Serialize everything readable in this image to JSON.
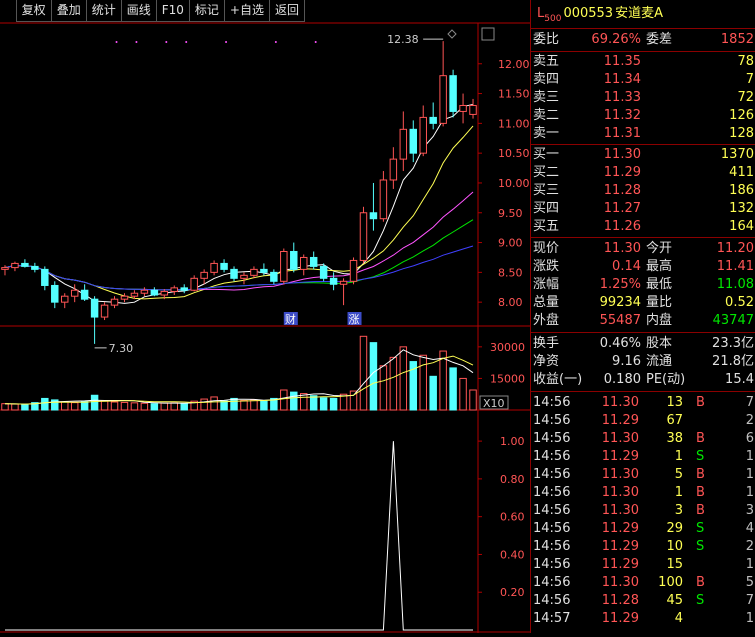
{
  "toolbar": [
    "复权",
    "叠加",
    "统计",
    "画线",
    "F10",
    "标记",
    "+自选",
    "返回"
  ],
  "stock": {
    "prefix": "L",
    "sub": "500",
    "code": "000553",
    "name": "安道麦A"
  },
  "commission": {
    "ratio_label": "委比",
    "ratio": "69.26%",
    "diff_label": "委差",
    "diff": "1852"
  },
  "asks": [
    {
      "label": "卖五",
      "price": "11.35",
      "vol": "78"
    },
    {
      "label": "卖四",
      "price": "11.34",
      "vol": "7"
    },
    {
      "label": "卖三",
      "price": "11.33",
      "vol": "72"
    },
    {
      "label": "卖二",
      "price": "11.32",
      "vol": "126"
    },
    {
      "label": "卖一",
      "price": "11.31",
      "vol": "128"
    }
  ],
  "bids": [
    {
      "label": "买一",
      "price": "11.30",
      "vol": "1370"
    },
    {
      "label": "买二",
      "price": "11.29",
      "vol": "411"
    },
    {
      "label": "买三",
      "price": "11.28",
      "vol": "186"
    },
    {
      "label": "买四",
      "price": "11.27",
      "vol": "132"
    },
    {
      "label": "买五",
      "price": "11.26",
      "vol": "164"
    }
  ],
  "quote": [
    {
      "l1": "现价",
      "v1": "11.30",
      "c1": "red",
      "l2": "今开",
      "v2": "11.20",
      "c2": "red"
    },
    {
      "l1": "涨跌",
      "v1": "0.14",
      "c1": "red",
      "l2": "最高",
      "v2": "11.41",
      "c2": "red"
    },
    {
      "l1": "涨幅",
      "v1": "1.25%",
      "c1": "red",
      "l2": "最低",
      "v2": "11.08",
      "c2": "green"
    },
    {
      "l1": "总量",
      "v1": "99234",
      "c1": "yel",
      "l2": "量比",
      "v2": "0.52",
      "c2": "yel"
    },
    {
      "l1": "外盘",
      "v1": "55487",
      "c1": "red",
      "l2": "内盘",
      "v2": "43747",
      "c2": "green"
    }
  ],
  "fundamentals": [
    {
      "l1": "换手",
      "v1": "0.46%",
      "l2": "股本",
      "v2": "23.3亿"
    },
    {
      "l1": "净资",
      "v1": "9.16",
      "l2": "流通",
      "v2": "21.8亿"
    },
    {
      "l1": "收益(一)",
      "v1": "0.180",
      "l2": "PE(动)",
      "v2": "15.4"
    }
  ],
  "ticks": [
    {
      "time": "14:56",
      "price": "11.30",
      "vol": "13",
      "side": "B",
      "cnt": "7"
    },
    {
      "time": "14:56",
      "price": "11.29",
      "vol": "67",
      "side": "",
      "cnt": "2"
    },
    {
      "time": "14:56",
      "price": "11.30",
      "vol": "38",
      "side": "B",
      "cnt": "6"
    },
    {
      "time": "14:56",
      "price": "11.29",
      "vol": "1",
      "side": "S",
      "cnt": "1"
    },
    {
      "time": "14:56",
      "price": "11.30",
      "vol": "5",
      "side": "B",
      "cnt": "1"
    },
    {
      "time": "14:56",
      "price": "11.30",
      "vol": "1",
      "side": "B",
      "cnt": "1"
    },
    {
      "time": "14:56",
      "price": "11.30",
      "vol": "3",
      "side": "B",
      "cnt": "3"
    },
    {
      "time": "14:56",
      "price": "11.29",
      "vol": "29",
      "side": "S",
      "cnt": "4"
    },
    {
      "time": "14:56",
      "price": "11.29",
      "vol": "10",
      "side": "S",
      "cnt": "2"
    },
    {
      "time": "14:56",
      "price": "11.29",
      "vol": "15",
      "side": "",
      "cnt": "1"
    },
    {
      "time": "14:56",
      "price": "11.30",
      "vol": "100",
      "side": "B",
      "cnt": "5"
    },
    {
      "time": "14:56",
      "price": "11.28",
      "vol": "45",
      "side": "S",
      "cnt": "7"
    },
    {
      "time": "14:57",
      "price": "11.29",
      "vol": "4",
      "side": "",
      "cnt": "1"
    }
  ],
  "colors": {
    "up": "#ff5555",
    "down": "#54ffff",
    "ma5": "#ffffff",
    "ma10": "#ffff54",
    "ma20": "#ff54ff",
    "ma60": "#00e600",
    "ma120": "#4040ff"
  },
  "chart_data": {
    "type": "candlestick",
    "price_axis": {
      "ticks": [
        8.0,
        8.5,
        9.0,
        9.5,
        10.0,
        10.5,
        11.0,
        11.5,
        12.0
      ],
      "range": [
        7.6,
        12.6
      ]
    },
    "annotations": {
      "high_label": "12.38",
      "low_label": "7.30",
      "tag_finance": "财",
      "tag_rise": "涨"
    },
    "candles": [
      [
        8.55,
        8.62,
        8.45,
        8.58
      ],
      [
        8.58,
        8.68,
        8.52,
        8.65
      ],
      [
        8.65,
        8.72,
        8.58,
        8.6
      ],
      [
        8.6,
        8.66,
        8.5,
        8.55
      ],
      [
        8.55,
        8.6,
        8.2,
        8.28
      ],
      [
        8.28,
        8.35,
        7.9,
        8.0
      ],
      [
        8.0,
        8.15,
        7.9,
        8.1
      ],
      [
        8.1,
        8.3,
        8.0,
        8.2
      ],
      [
        8.2,
        8.3,
        8.02,
        8.05
      ],
      [
        8.05,
        8.1,
        7.3,
        7.75
      ],
      [
        7.75,
        8.0,
        7.7,
        7.95
      ],
      [
        7.95,
        8.1,
        7.9,
        8.05
      ],
      [
        8.05,
        8.15,
        8.0,
        8.1
      ],
      [
        8.1,
        8.2,
        8.05,
        8.15
      ],
      [
        8.15,
        8.25,
        8.1,
        8.2
      ],
      [
        8.2,
        8.25,
        8.1,
        8.12
      ],
      [
        8.12,
        8.22,
        8.05,
        8.18
      ],
      [
        8.18,
        8.28,
        8.12,
        8.24
      ],
      [
        8.24,
        8.3,
        8.15,
        8.2
      ],
      [
        8.2,
        8.45,
        8.18,
        8.4
      ],
      [
        8.4,
        8.55,
        8.3,
        8.5
      ],
      [
        8.5,
        8.7,
        8.45,
        8.65
      ],
      [
        8.65,
        8.72,
        8.5,
        8.55
      ],
      [
        8.55,
        8.6,
        8.35,
        8.4
      ],
      [
        8.4,
        8.5,
        8.3,
        8.45
      ],
      [
        8.45,
        8.6,
        8.4,
        8.55
      ],
      [
        8.55,
        8.65,
        8.45,
        8.5
      ],
      [
        8.5,
        8.55,
        8.3,
        8.35
      ],
      [
        8.35,
        8.9,
        8.3,
        8.85
      ],
      [
        8.85,
        9.0,
        8.5,
        8.55
      ],
      [
        8.55,
        8.8,
        8.45,
        8.75
      ],
      [
        8.75,
        8.85,
        8.55,
        8.6
      ],
      [
        8.6,
        8.65,
        8.35,
        8.4
      ],
      [
        8.4,
        8.5,
        8.2,
        8.3
      ],
      [
        8.3,
        8.4,
        7.95,
        8.35
      ],
      [
        8.35,
        8.75,
        8.3,
        8.7
      ],
      [
        8.7,
        9.6,
        8.65,
        9.5
      ],
      [
        9.5,
        10.0,
        9.2,
        9.4
      ],
      [
        9.4,
        10.2,
        9.35,
        10.05
      ],
      [
        10.05,
        10.6,
        9.9,
        10.4
      ],
      [
        10.4,
        11.2,
        10.2,
        10.9
      ],
      [
        10.9,
        11.05,
        10.35,
        10.5
      ],
      [
        10.5,
        11.3,
        10.45,
        11.1
      ],
      [
        11.1,
        11.35,
        10.9,
        11.0
      ],
      [
        11.0,
        12.38,
        10.95,
        11.8
      ],
      [
        11.8,
        11.9,
        11.1,
        11.2
      ],
      [
        11.2,
        11.5,
        11.0,
        11.3
      ],
      [
        11.15,
        11.41,
        11.08,
        11.3
      ]
    ],
    "volume_axis": {
      "ticks": [
        15000,
        30000
      ],
      "label": "X10"
    },
    "volume": [
      3000,
      2800,
      2600,
      3500,
      5500,
      4800,
      3800,
      3500,
      4000,
      7000,
      4200,
      3800,
      3600,
      3400,
      3200,
      3000,
      3300,
      3400,
      3100,
      4200,
      5200,
      6200,
      4200,
      5500,
      4500,
      4800,
      4200,
      5500,
      9500,
      8500,
      7800,
      6800,
      5800,
      5500,
      7500,
      9000,
      35000,
      32000,
      21000,
      25000,
      30000,
      23000,
      26000,
      16000,
      28000,
      20000,
      15000,
      9500
    ],
    "indicator_axis": {
      "ticks": [
        0.2,
        0.4,
        0.6,
        0.8,
        1.0
      ],
      "range": [
        0,
        1.08
      ]
    },
    "indicator": [
      0,
      0,
      0,
      0,
      0,
      0,
      0,
      0,
      0,
      0,
      0,
      0,
      0,
      0,
      0,
      0,
      0,
      0,
      0,
      0,
      0,
      0,
      0,
      0,
      0,
      0,
      0,
      0,
      0,
      0,
      0,
      0,
      0,
      0,
      0,
      0,
      0,
      0,
      0,
      1.0,
      0,
      0,
      0,
      0,
      0,
      0,
      0,
      0
    ]
  }
}
